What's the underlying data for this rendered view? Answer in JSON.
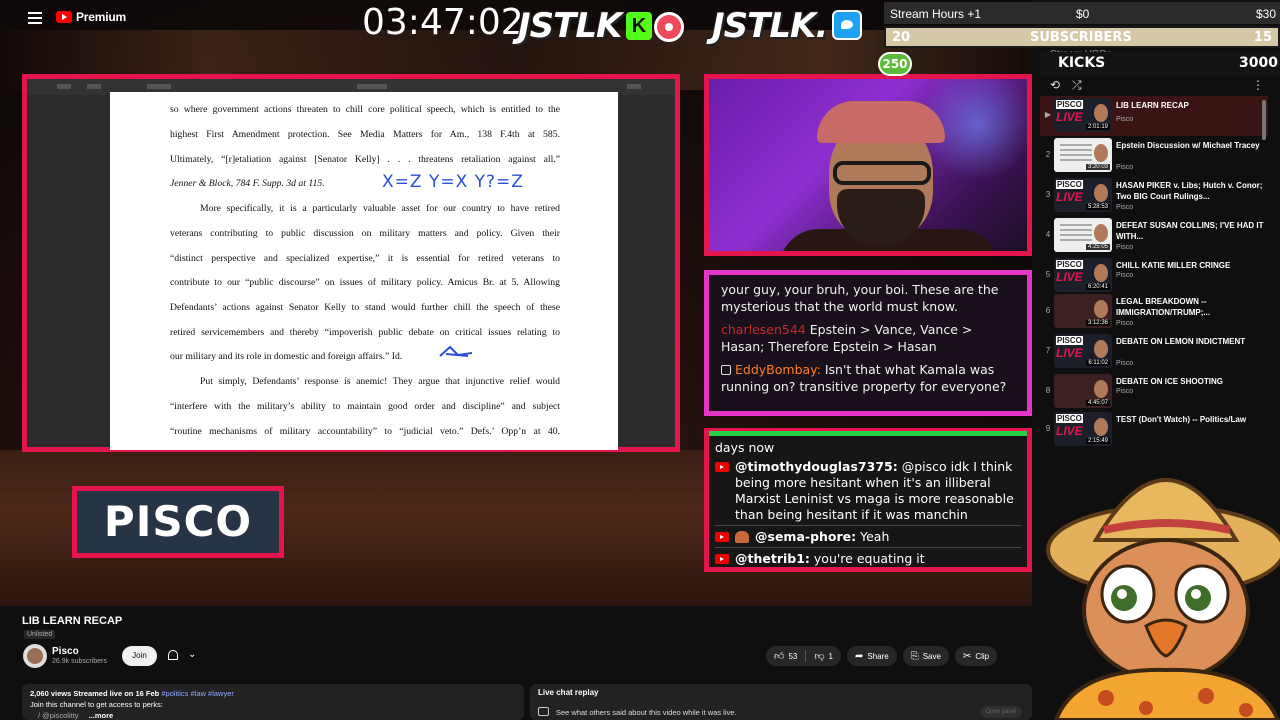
{
  "app": {
    "brand": "Premium"
  },
  "stream": {
    "timer": "03:47:02",
    "logo_text": "JSTLK",
    "logo_text_2": "JSTLK.",
    "kick_letter": "K",
    "stream_hours_label": "Stream Hours +1",
    "stream_hours_min": "$0",
    "stream_hours_max": "$30",
    "subs_current": "20",
    "subs_label": "SUBSCRIBERS",
    "subs_goal": "15",
    "kicks_label": "KICKS",
    "kicks_value": "3000",
    "badge_250": "250",
    "stream_vods": "Stream VODs",
    "pisco_tag": "PISCO"
  },
  "document": {
    "lines": [
      "so where government actions threaten to chill core political speech, which is entitled to the",
      "highest First Amendment protection.   See Media Matters for Am., 138 F.4th at 585.",
      "Ultimately, “[r]etaliation against [Senator Kelly] . . . threatens retaliation against all.”",
      "Jenner & Block, 784 F. Supp. 3d at 115.",
      "More specifically, it is a particularly valuable asset for our country to have retired",
      "veterans contributing to public discussion on military matters and policy.  Given their",
      "“distinct perspective and specialized expertise,” it is essential for retired veterans to",
      "contribute to our “public discourse” on issues of military policy.  Amicus Br. at 5.  Allowing",
      "Defendants’ actions against Senator Kelly to stand would further chill the speech of these",
      "retired servicemembers and thereby “impoverish public debate on critical issues relating to",
      "our military and its role in domestic and foreign affairs.”  Id.",
      "Put simply, Defendants’ response is anemic!  They argue that injunctive relief would",
      "“interfere with the military’s ability to maintain good order and discipline” and subject",
      "“routine mechanisms of military accountability” to “judicial veto.”  Defs.’ Opp’n at 40."
    ],
    "handwriting": "X=Z  Y=X  Y?=Z"
  },
  "chat_overlay_1": {
    "line1": "your guy, your bruh, your boi. These are the mysterious that the world must know.",
    "msg2_user": "charlesen544",
    "msg2_text": "Epstein > Vance, Vance > Hasan; Therefore Epstein > Hasan",
    "msg3_user": "EddyBombay:",
    "msg3_text": "Isn't that what Kamala was running on? transitive property for everyone?"
  },
  "chat_overlay_2": {
    "line0": "days now",
    "msg1_user": "@timothydouglas7375:",
    "msg1_text": "@pisco idk I think being more hesitant when it's an illiberal Marxist Leninist vs maga is more reasonable than being hesitant if it was manchin",
    "msg2_user": "@sema-phore:",
    "msg2_text": "Yeah",
    "msg3_user": "@thetrib1:",
    "msg3_text": "you're equating it"
  },
  "playlist": {
    "items": [
      {
        "idx": "▶",
        "title": "LIB LEARN RECAP",
        "channel": "Pisco",
        "duration": "2:01:19",
        "thumb": "pisco"
      },
      {
        "idx": "2",
        "title": "Epstein Discussion w/ Michael Tracey",
        "channel": "Pisco",
        "duration": "3:20:03",
        "thumb": "doc"
      },
      {
        "idx": "3",
        "title": "HASAN PIKER v. Libs; Hutch v. Conor; Two BIG Court Rulings...",
        "channel": "Pisco",
        "duration": "5:28:53",
        "thumb": "pisco"
      },
      {
        "idx": "4",
        "title": "DEFEAT SUSAN COLLINS; I'VE HAD IT WITH...",
        "channel": "Pisco",
        "duration": "4:25:05",
        "thumb": "doc"
      },
      {
        "idx": "5",
        "title": "CHILL KATIE MILLER CRINGE",
        "channel": "Pisco",
        "duration": "6:20:41",
        "thumb": "pisco"
      },
      {
        "idx": "6",
        "title": "LEGAL BREAKDOWN -- IMMIGRATION/TRUMP;...",
        "channel": "Pisco",
        "duration": "3:12:36",
        "thumb": "red"
      },
      {
        "idx": "7",
        "title": "DEBATE ON LEMON INDICTMENT",
        "channel": "Pisco",
        "duration": "6:11:02",
        "thumb": "pisco"
      },
      {
        "idx": "8",
        "title": "DEBATE ON ICE SHOOTING",
        "channel": "Pisco",
        "duration": "4:45:07",
        "thumb": "red"
      },
      {
        "idx": "9",
        "title": "TEST (Don't Watch) -- Politics/Law",
        "channel": "Pisco",
        "duration": "2:15:49",
        "thumb": "pisco"
      }
    ]
  },
  "video": {
    "title": "LIB LEARN RECAP",
    "visibility": "Unlisted",
    "channel": "Pisco",
    "subscribers": "26.9k subscribers",
    "join_label": "Join",
    "likes": "53",
    "dislikes": "1",
    "share_label": "Share",
    "save_label": "Save",
    "clip_label": "Clip",
    "views_line": "2,060 views  Streamed live on 16 Feb",
    "hashtags": "#politics #law #lawyer",
    "desc_line2": "Join this channel to get access to perks:",
    "desc_line3": "/ @piscolitty",
    "more_label": "...more",
    "live_chat_title": "Live chat replay",
    "live_chat_sub": "See what others said about this video while it was live.",
    "open_panel": "Open panel"
  },
  "colors": {
    "accent_red": "#e4154d",
    "chat_pink": "#e436c8",
    "kick_green": "#53fc18"
  }
}
